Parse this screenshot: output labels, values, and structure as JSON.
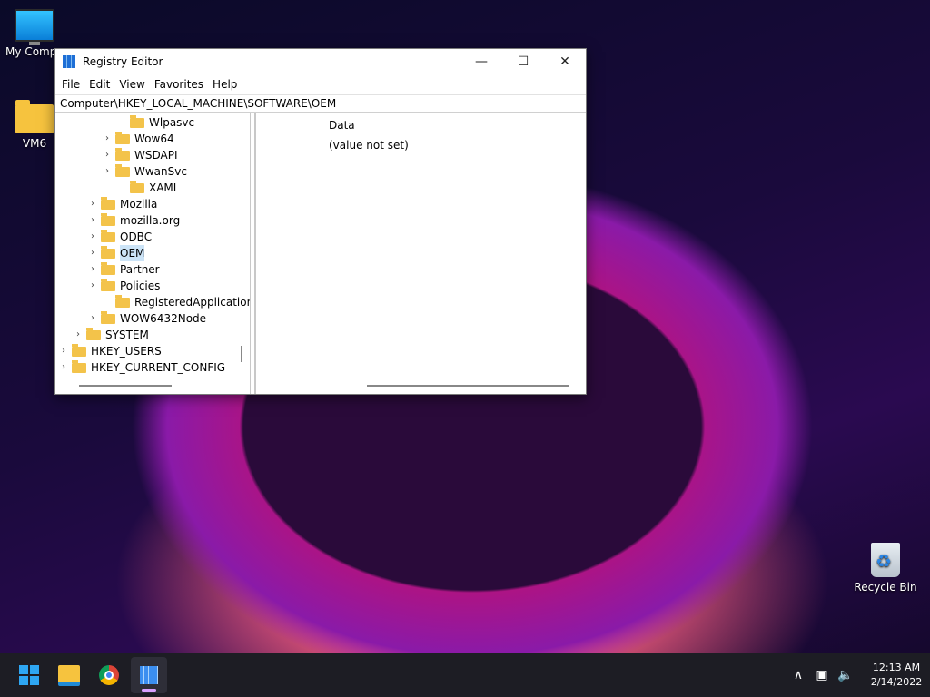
{
  "desktop": {
    "icons": [
      {
        "label": "My Compu",
        "icon": "monitor-icon"
      },
      {
        "label": "VM6",
        "icon": "folder-icon"
      },
      {
        "label": "Recycle Bin",
        "icon": "recycle-bin-icon"
      }
    ]
  },
  "window": {
    "title": "Registry Editor",
    "controls": {
      "minimize": "—",
      "maximize": "☐",
      "close": "✕"
    },
    "menu": [
      "File",
      "Edit",
      "View",
      "Favorites",
      "Help"
    ],
    "address": "Computer\\HKEY_LOCAL_MACHINE\\SOFTWARE\\OEM",
    "tree": [
      {
        "label": "Wlpasvc",
        "expandable": false
      },
      {
        "label": "Wow64",
        "expandable": true
      },
      {
        "label": "WSDAPI",
        "expandable": true
      },
      {
        "label": "WwanSvc",
        "expandable": true
      },
      {
        "label": "XAML",
        "expandable": false
      },
      {
        "label": "Mozilla",
        "expandable": true
      },
      {
        "label": "mozilla.org",
        "expandable": true
      },
      {
        "label": "ODBC",
        "expandable": true
      },
      {
        "label": "OEM",
        "expandable": true,
        "selected": true
      },
      {
        "label": "Partner",
        "expandable": true
      },
      {
        "label": "Policies",
        "expandable": true
      },
      {
        "label": "RegisteredApplications",
        "expandable": false
      },
      {
        "label": "WOW6432Node",
        "expandable": true
      },
      {
        "label": "SYSTEM",
        "expandable": true
      },
      {
        "label": "HKEY_USERS",
        "expandable": true
      },
      {
        "label": "HKEY_CURRENT_CONFIG",
        "expandable": true
      }
    ],
    "values": {
      "column_header": "Data",
      "cell": "(value not set)"
    }
  },
  "taskbar": {
    "apps": [
      "start-icon",
      "file-explorer-icon",
      "chrome-icon",
      "registry-editor-icon"
    ],
    "tray": {
      "chevron": "∧",
      "network": "▣",
      "volume": "🔈"
    },
    "time": "12:13 AM",
    "date": "2/14/2022"
  },
  "colors": {
    "selection": "#cce4f7",
    "folder": "#f3c34a",
    "taskbar": "#1d1d24"
  }
}
